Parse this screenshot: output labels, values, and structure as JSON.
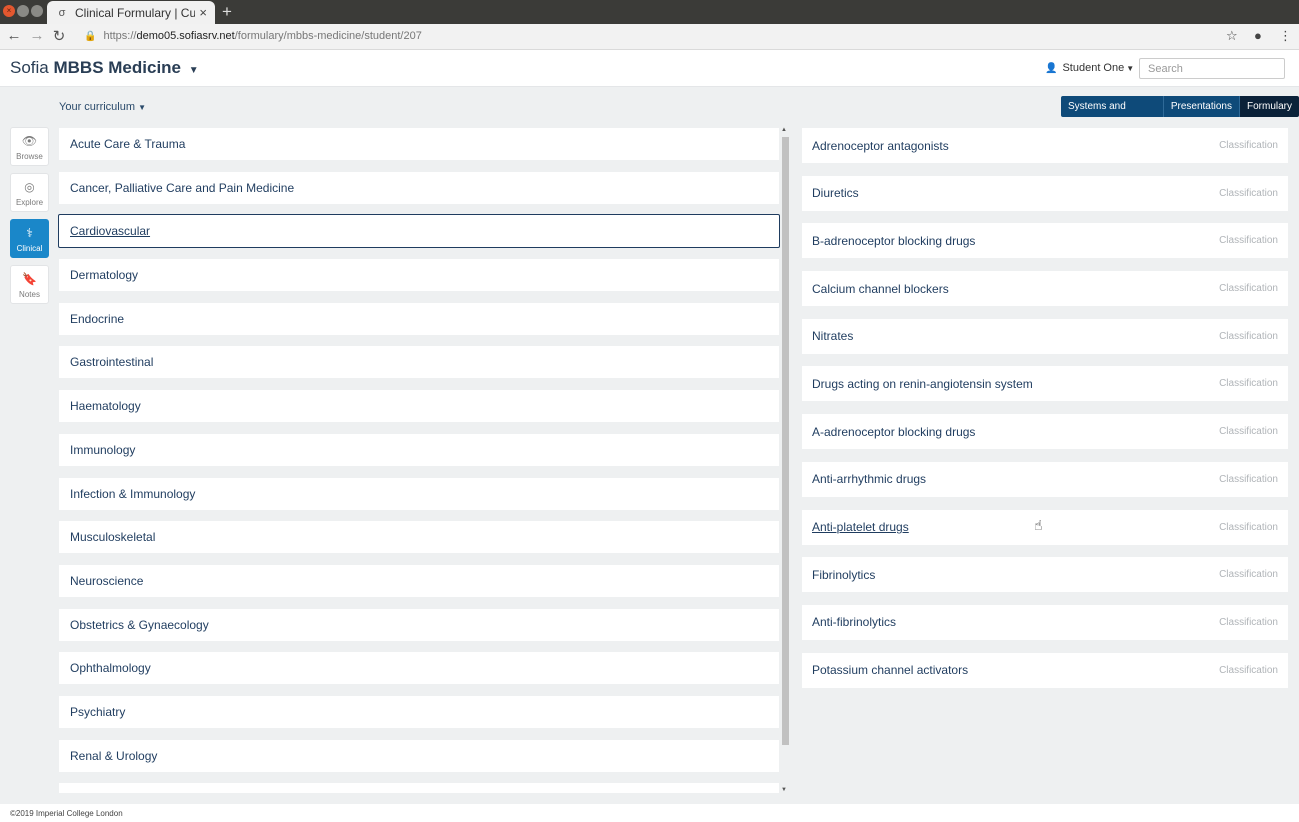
{
  "browser": {
    "tab_title": "Clinical Formulary | Curric",
    "url_scheme": "https://",
    "url_host": "demo05.sofiasrv.net",
    "url_path": "/formulary/mbbs-medicine/student/207"
  },
  "header": {
    "brand_light": "Sofia",
    "brand_bold": "MBBS Medicine",
    "user": "Student One",
    "search_placeholder": "Search"
  },
  "curriculum_label": "Your curriculum",
  "view_switcher": [
    {
      "label": "Systems and Specialties"
    },
    {
      "label": "Presentations"
    },
    {
      "label": "Formulary"
    }
  ],
  "sidenav": [
    {
      "label": "Browse"
    },
    {
      "label": "Explore"
    },
    {
      "label": "Clinical"
    },
    {
      "label": "Notes"
    }
  ],
  "systems": [
    "Acute Care & Trauma",
    "Cancer, Palliative Care and Pain Medicine",
    "Cardiovascular",
    "Dermatology",
    "Endocrine",
    "Gastrointestinal",
    "Haematology",
    "Immunology",
    "Infection & Immunology",
    "Musculoskeletal",
    "Neuroscience",
    "Obstetrics & Gynaecology",
    "Ophthalmology",
    "Psychiatry",
    "Renal & Urology",
    ""
  ],
  "drugs": [
    {
      "name": "Adrenoceptor antagonists",
      "type": "Classification"
    },
    {
      "name": "Diuretics",
      "type": "Classification"
    },
    {
      "name": "B-adrenoceptor blocking drugs",
      "type": "Classification"
    },
    {
      "name": "Calcium channel blockers",
      "type": "Classification"
    },
    {
      "name": "Nitrates",
      "type": "Classification"
    },
    {
      "name": "Drugs acting on renin-angiotensin system",
      "type": "Classification"
    },
    {
      "name": "A-adrenoceptor blocking drugs",
      "type": "Classification"
    },
    {
      "name": "Anti-arrhythmic drugs",
      "type": "Classification"
    },
    {
      "name": "Anti-platelet drugs",
      "type": "Classification"
    },
    {
      "name": "Fibrinolytics",
      "type": "Classification"
    },
    {
      "name": "Anti-fibrinolytics",
      "type": "Classification"
    },
    {
      "name": "Potassium channel activators",
      "type": "Classification"
    }
  ],
  "footer": "©2019 Imperial College London"
}
